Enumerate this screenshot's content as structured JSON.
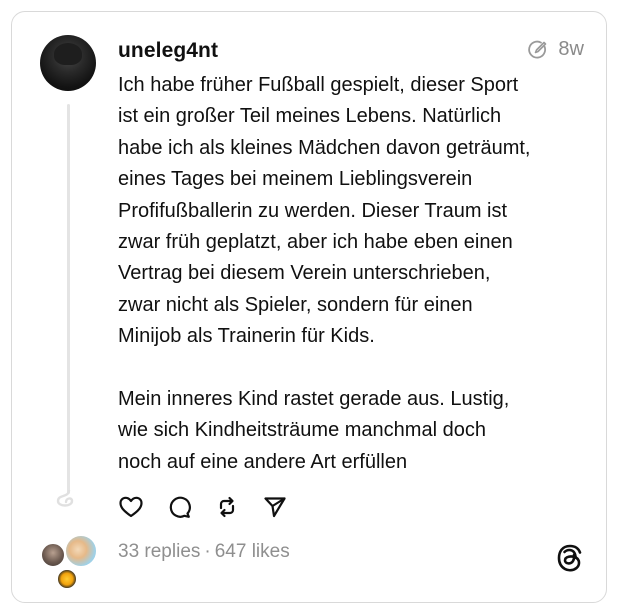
{
  "post": {
    "username": "uneleg4nt",
    "time_ago": "8w",
    "paragraphs": [
      "Ich habe früher Fußball gespielt, dieser Sport\nist ein großer Teil meines Lebens. Natürlich\nhabe ich als kleines Mädchen davon geträumt,\neines Tages bei meinem Lieblingsverein\nProfifußballerin zu werden. Dieser Traum ist\nzwar früh geplatzt, aber ich habe eben einen\nVertrag bei diesem Verein unterschrieben,\nzwar nicht als Spieler, sondern für einen\nMinijob als Trainerin für Kids.",
      "Mein inneres Kind rastet gerade aus. Lustig,\nwie sich Kindheitsträume manchmal doch\nnoch auf eine andere Art erfüllen"
    ],
    "replies": "33 replies",
    "separator": "·",
    "likes": "647 likes"
  },
  "icons": {
    "edited": "edited-pencil-icon",
    "like": "heart-icon",
    "reply": "comment-bubble-icon",
    "repost": "repost-icon",
    "share": "send-icon",
    "brand": "threads-logo-icon"
  },
  "colors": {
    "text": "#101010",
    "muted": "#8a8a8a",
    "border": "#d9d9d9"
  }
}
